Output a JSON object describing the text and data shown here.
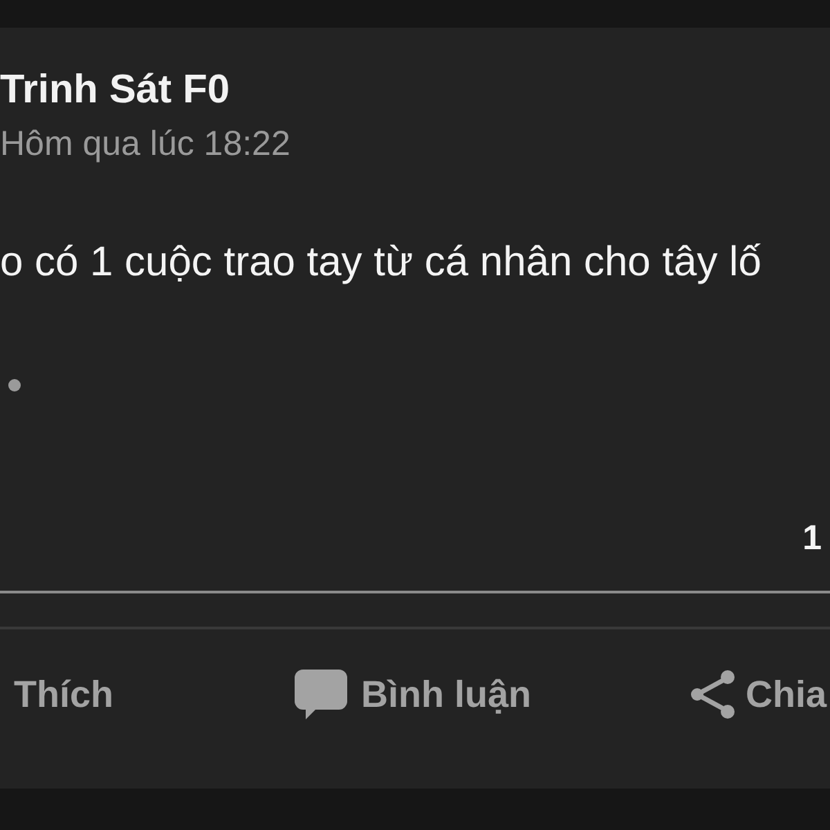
{
  "post": {
    "author": "Trinh Sát F0",
    "time": "Hôm qua lúc 18:22",
    "text": "o có 1 cuộc trao tay từ cá nhân cho tây lố",
    "reaction_count": "1"
  },
  "actions": [
    {
      "kind": "like",
      "label": "Thích"
    },
    {
      "kind": "comment",
      "label": "Bình luận"
    },
    {
      "kind": "share",
      "label": "Chia"
    }
  ]
}
